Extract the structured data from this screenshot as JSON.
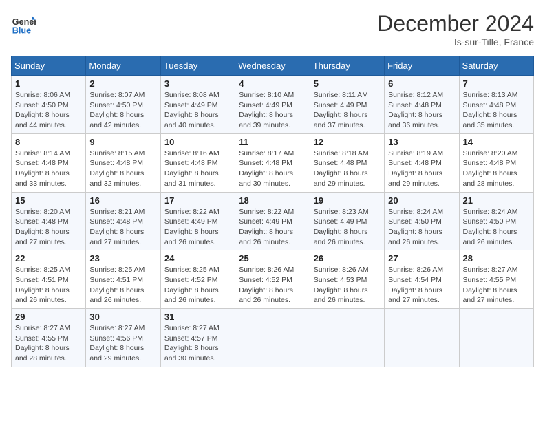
{
  "header": {
    "logo_line1": "General",
    "logo_line2": "Blue",
    "month": "December 2024",
    "location": "Is-sur-Tille, France"
  },
  "days_of_week": [
    "Sunday",
    "Monday",
    "Tuesday",
    "Wednesday",
    "Thursday",
    "Friday",
    "Saturday"
  ],
  "weeks": [
    [
      {
        "day": "1",
        "sunrise": "8:06 AM",
        "sunset": "4:50 PM",
        "daylight": "8 hours and 44 minutes."
      },
      {
        "day": "2",
        "sunrise": "8:07 AM",
        "sunset": "4:50 PM",
        "daylight": "8 hours and 42 minutes."
      },
      {
        "day": "3",
        "sunrise": "8:08 AM",
        "sunset": "4:49 PM",
        "daylight": "8 hours and 40 minutes."
      },
      {
        "day": "4",
        "sunrise": "8:10 AM",
        "sunset": "4:49 PM",
        "daylight": "8 hours and 39 minutes."
      },
      {
        "day": "5",
        "sunrise": "8:11 AM",
        "sunset": "4:49 PM",
        "daylight": "8 hours and 37 minutes."
      },
      {
        "day": "6",
        "sunrise": "8:12 AM",
        "sunset": "4:48 PM",
        "daylight": "8 hours and 36 minutes."
      },
      {
        "day": "7",
        "sunrise": "8:13 AM",
        "sunset": "4:48 PM",
        "daylight": "8 hours and 35 minutes."
      }
    ],
    [
      {
        "day": "8",
        "sunrise": "8:14 AM",
        "sunset": "4:48 PM",
        "daylight": "8 hours and 33 minutes."
      },
      {
        "day": "9",
        "sunrise": "8:15 AM",
        "sunset": "4:48 PM",
        "daylight": "8 hours and 32 minutes."
      },
      {
        "day": "10",
        "sunrise": "8:16 AM",
        "sunset": "4:48 PM",
        "daylight": "8 hours and 31 minutes."
      },
      {
        "day": "11",
        "sunrise": "8:17 AM",
        "sunset": "4:48 PM",
        "daylight": "8 hours and 30 minutes."
      },
      {
        "day": "12",
        "sunrise": "8:18 AM",
        "sunset": "4:48 PM",
        "daylight": "8 hours and 29 minutes."
      },
      {
        "day": "13",
        "sunrise": "8:19 AM",
        "sunset": "4:48 PM",
        "daylight": "8 hours and 29 minutes."
      },
      {
        "day": "14",
        "sunrise": "8:20 AM",
        "sunset": "4:48 PM",
        "daylight": "8 hours and 28 minutes."
      }
    ],
    [
      {
        "day": "15",
        "sunrise": "8:20 AM",
        "sunset": "4:48 PM",
        "daylight": "8 hours and 27 minutes."
      },
      {
        "day": "16",
        "sunrise": "8:21 AM",
        "sunset": "4:48 PM",
        "daylight": "8 hours and 27 minutes."
      },
      {
        "day": "17",
        "sunrise": "8:22 AM",
        "sunset": "4:49 PM",
        "daylight": "8 hours and 26 minutes."
      },
      {
        "day": "18",
        "sunrise": "8:22 AM",
        "sunset": "4:49 PM",
        "daylight": "8 hours and 26 minutes."
      },
      {
        "day": "19",
        "sunrise": "8:23 AM",
        "sunset": "4:49 PM",
        "daylight": "8 hours and 26 minutes."
      },
      {
        "day": "20",
        "sunrise": "8:24 AM",
        "sunset": "4:50 PM",
        "daylight": "8 hours and 26 minutes."
      },
      {
        "day": "21",
        "sunrise": "8:24 AM",
        "sunset": "4:50 PM",
        "daylight": "8 hours and 26 minutes."
      }
    ],
    [
      {
        "day": "22",
        "sunrise": "8:25 AM",
        "sunset": "4:51 PM",
        "daylight": "8 hours and 26 minutes."
      },
      {
        "day": "23",
        "sunrise": "8:25 AM",
        "sunset": "4:51 PM",
        "daylight": "8 hours and 26 minutes."
      },
      {
        "day": "24",
        "sunrise": "8:25 AM",
        "sunset": "4:52 PM",
        "daylight": "8 hours and 26 minutes."
      },
      {
        "day": "25",
        "sunrise": "8:26 AM",
        "sunset": "4:52 PM",
        "daylight": "8 hours and 26 minutes."
      },
      {
        "day": "26",
        "sunrise": "8:26 AM",
        "sunset": "4:53 PM",
        "daylight": "8 hours and 26 minutes."
      },
      {
        "day": "27",
        "sunrise": "8:26 AM",
        "sunset": "4:54 PM",
        "daylight": "8 hours and 27 minutes."
      },
      {
        "day": "28",
        "sunrise": "8:27 AM",
        "sunset": "4:55 PM",
        "daylight": "8 hours and 27 minutes."
      }
    ],
    [
      {
        "day": "29",
        "sunrise": "8:27 AM",
        "sunset": "4:55 PM",
        "daylight": "8 hours and 28 minutes."
      },
      {
        "day": "30",
        "sunrise": "8:27 AM",
        "sunset": "4:56 PM",
        "daylight": "8 hours and 29 minutes."
      },
      {
        "day": "31",
        "sunrise": "8:27 AM",
        "sunset": "4:57 PM",
        "daylight": "8 hours and 30 minutes."
      },
      null,
      null,
      null,
      null
    ]
  ],
  "labels": {
    "sunrise": "Sunrise:",
    "sunset": "Sunset:",
    "daylight": "Daylight:"
  }
}
